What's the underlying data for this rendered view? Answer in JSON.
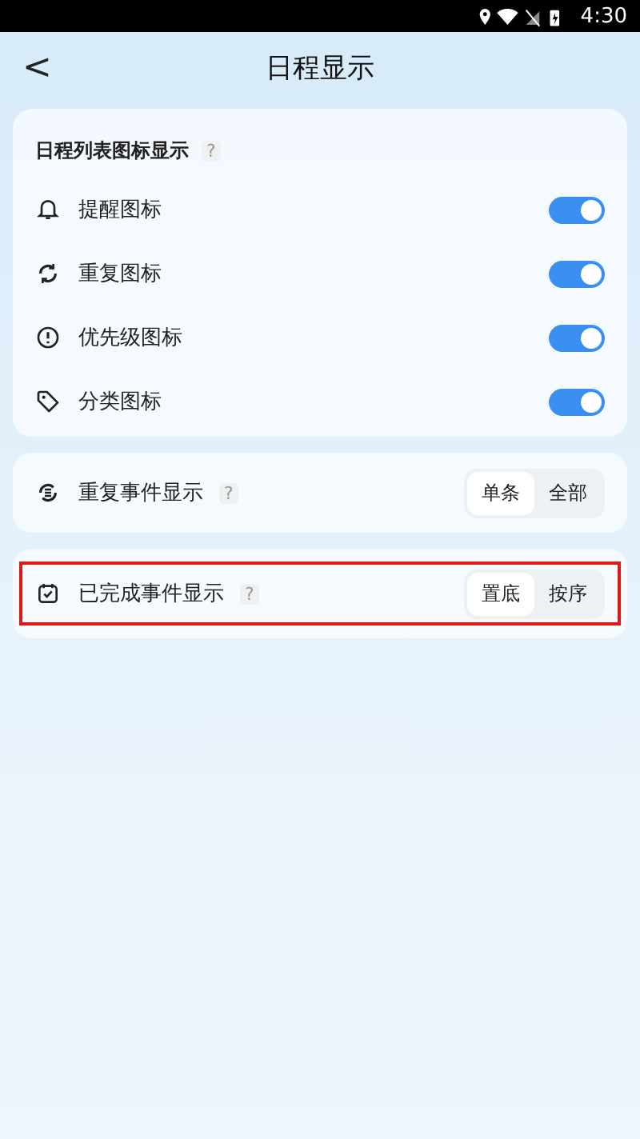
{
  "status_bar": {
    "time": "4:30"
  },
  "header": {
    "back": "<",
    "title": "日程显示"
  },
  "icon_section": {
    "title": "日程列表图标显示",
    "help": "?",
    "items": [
      {
        "label": "提醒图标",
        "on": true
      },
      {
        "label": "重复图标",
        "on": true
      },
      {
        "label": "优先级图标",
        "on": true
      },
      {
        "label": "分类图标",
        "on": true
      }
    ]
  },
  "option_rows": [
    {
      "label": "重复事件显示",
      "help": "?",
      "highlighted": false,
      "options": [
        {
          "label": "单条",
          "selected": true
        },
        {
          "label": "全部",
          "selected": false
        }
      ]
    },
    {
      "label": "已完成事件显示",
      "help": "?",
      "highlighted": true,
      "options": [
        {
          "label": "置底",
          "selected": true
        },
        {
          "label": "按序",
          "selected": false
        }
      ]
    }
  ]
}
